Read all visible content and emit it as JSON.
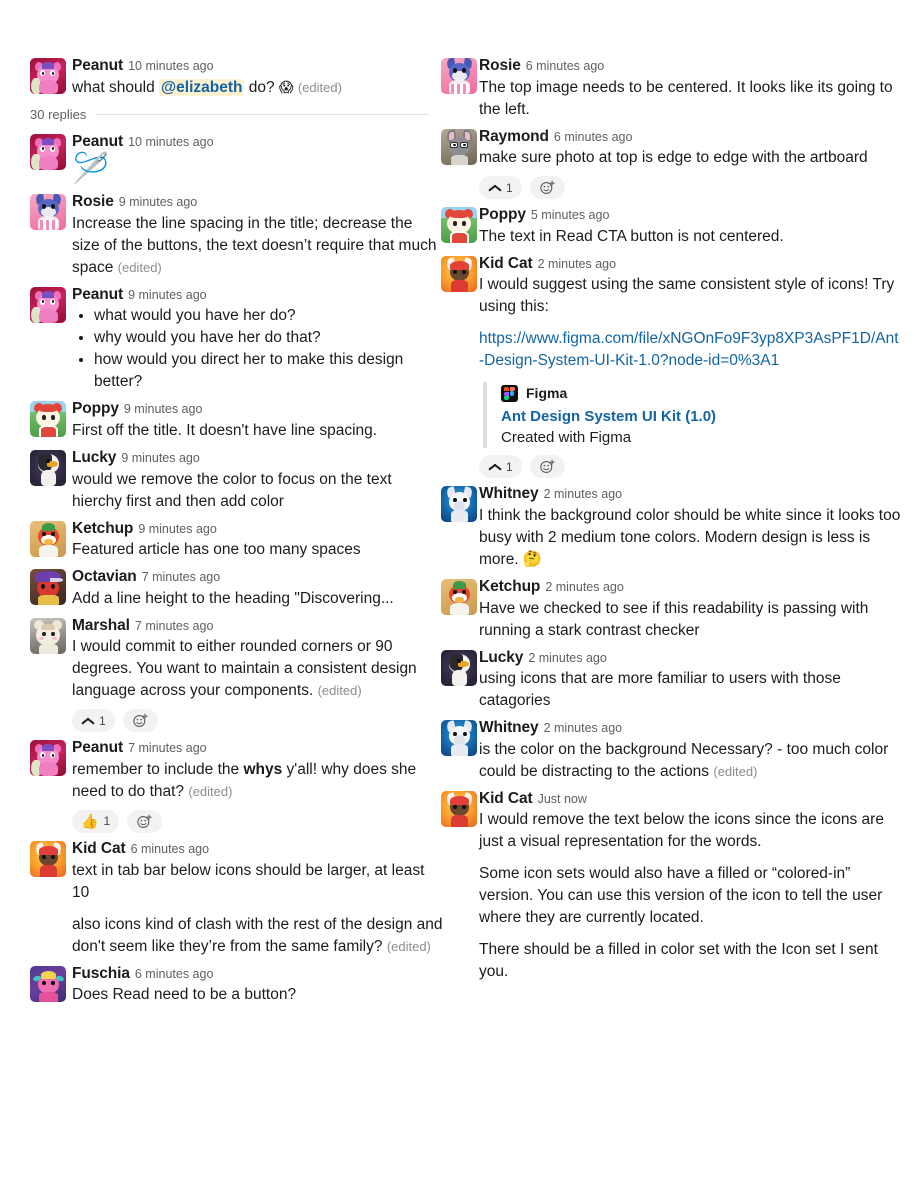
{
  "thread": {
    "replies_label": "30 replies",
    "root": {
      "user": "Peanut",
      "avatar": "peanut",
      "timestamp": "10 minutes ago",
      "text_before": "what should ",
      "mention": "@elizabeth",
      "text_after": " do? ",
      "emoji": "😱",
      "edited": "(edited)"
    }
  },
  "reactions": {
    "chevron_count": "1",
    "thumbsup_emoji": "👍",
    "thumbsup_count": "1",
    "add_reaction_label": "add reaction"
  },
  "attachment": {
    "app_name": "Figma",
    "title": "Ant Design System UI Kit (1.0)",
    "subtitle": "Created with Figma"
  },
  "left_column": [
    {
      "user": "Peanut",
      "avatar": "peanut",
      "timestamp": "10 minutes ago",
      "paragraphs": [
        "🪡"
      ],
      "is_big_emoji": true
    },
    {
      "user": "Rosie",
      "avatar": "rosie",
      "timestamp": "9 minutes ago",
      "paragraphs": [
        "Increase the line spacing in the title; decrease the size of the buttons, the text doesn’t require that much space"
      ],
      "edited": "(edited)"
    },
    {
      "user": "Peanut",
      "avatar": "peanut",
      "timestamp": "9 minutes ago",
      "bullets": [
        "what would you have her do?",
        "why would you have her do that?",
        "how would you direct her to make this design better?"
      ]
    },
    {
      "user": "Poppy",
      "avatar": "poppy",
      "timestamp": "9 minutes ago",
      "paragraphs": [
        "First off the title. It doesn't have line spacing."
      ]
    },
    {
      "user": "Lucky",
      "avatar": "lucky",
      "timestamp": "9 minutes ago",
      "paragraphs": [
        "would we remove the color to focus on the text hierchy first and then add color"
      ]
    },
    {
      "user": "Ketchup",
      "avatar": "ketchup",
      "timestamp": "9 minutes ago",
      "paragraphs": [
        "Featured article has one too many spaces"
      ]
    },
    {
      "user": "Octavian",
      "avatar": "octavian",
      "timestamp": "7 minutes ago",
      "paragraphs": [
        "Add a line height to the heading \"Discovering..."
      ]
    },
    {
      "user": "Marshal",
      "avatar": "marshal",
      "timestamp": "7 minutes ago",
      "paragraphs": [
        "I would commit to either rounded corners or 90 degrees. You want to maintain a consistent design language across your components."
      ],
      "edited": "(edited)",
      "reaction": "chevron"
    },
    {
      "user": "Peanut",
      "avatar": "peanut",
      "timestamp": "7 minutes ago",
      "rich": {
        "before": "remember to include the ",
        "bold": "whys",
        "after": " y'all! why does she need to do that?"
      },
      "edited": "(edited)",
      "reaction": "thumbsup"
    },
    {
      "user": "Kid Cat",
      "avatar": "kidcat",
      "timestamp": "6 minutes ago",
      "paragraphs": [
        "text in tab bar below icons should be larger, at least 10",
        "also icons kind of clash with the rest of the design and don't seem like they’re from the same family?"
      ],
      "edited": "(edited)"
    },
    {
      "user": "Fuschia",
      "avatar": "fuschia",
      "timestamp": "6 minutes ago",
      "paragraphs": [
        "Does Read need to be a button?"
      ]
    }
  ],
  "right_column": [
    {
      "user": "Rosie",
      "avatar": "rosie",
      "timestamp": "6 minutes ago",
      "paragraphs": [
        "The top image needs to be  centered. It looks like its going to the left."
      ]
    },
    {
      "user": "Raymond",
      "avatar": "raymond",
      "timestamp": "6 minutes ago",
      "paragraphs": [
        "make sure photo at top is edge to edge with the artboard"
      ],
      "reaction": "chevron"
    },
    {
      "user": "Poppy",
      "avatar": "poppy",
      "timestamp": "5 minutes ago",
      "paragraphs": [
        "The text in Read CTA button is not centered."
      ]
    },
    {
      "user": "Kid Cat",
      "avatar": "kidcat",
      "timestamp": "2 minutes ago",
      "paragraphs": [
        "I would suggest using the same consistent style of icons! Try using this:"
      ],
      "link": "https://www.figma.com/file/xNGOnFo9F3yp8XP3AsPF1D/Ant-Design-System-UI-Kit-1.0?node-id=0%3A1",
      "has_attachment": true,
      "reaction": "chevron"
    },
    {
      "user": "Whitney",
      "avatar": "whitney",
      "timestamp": "2 minutes ago",
      "paragraphs": [
        "I think the background color should be white since it looks too busy with 2 medium tone colors. Modern design is less is more. 🤔"
      ]
    },
    {
      "user": "Ketchup",
      "avatar": "ketchup",
      "timestamp": "2 minutes ago",
      "paragraphs": [
        "Have we checked to see if this readability is passing with running a stark contrast checker"
      ]
    },
    {
      "user": "Lucky",
      "avatar": "lucky",
      "timestamp": "2 minutes ago",
      "paragraphs": [
        "using icons that are more familiar to users with those catagories"
      ]
    },
    {
      "user": "Whitney",
      "avatar": "whitney",
      "timestamp": "2 minutes ago",
      "paragraphs": [
        "is the color on the background Necessary? - too much color could be distracting to the actions"
      ],
      "edited": "(edited)"
    },
    {
      "user": "Kid Cat",
      "avatar": "kidcat",
      "timestamp": "Just now",
      "paragraphs": [
        "I would remove the text below the icons since the icons are just a visual representation for the words.",
        "Some icon sets would also have a filled or “colored-in” version. You can use this version of the icon to tell the user where they are currently located.",
        "There should be a filled in color set with the Icon set I sent you."
      ]
    }
  ],
  "colors": {
    "text": "#1d1c1d",
    "meta": "#616061",
    "link": "#1264a3",
    "mention_bg": "#fdf2d0",
    "pill_bg": "#f2f2f2"
  }
}
